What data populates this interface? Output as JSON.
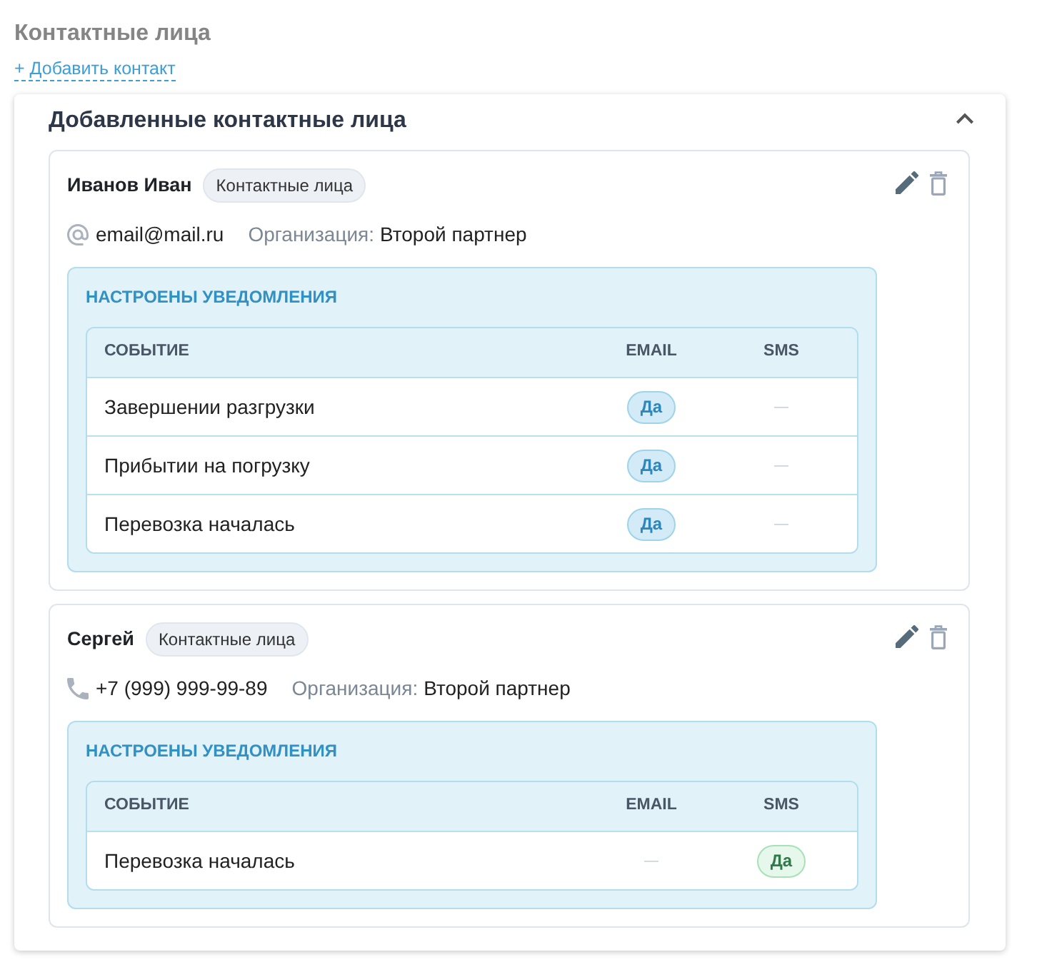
{
  "page": {
    "title": "Контактные лица",
    "add_link": "+ Добавить контакт"
  },
  "panel": {
    "title": "Добавленные контактные лица",
    "expanded": true
  },
  "contacts": [
    {
      "name": "Иванов Иван",
      "tag": "Контактные лица",
      "kind": "email",
      "contact": "email@mail.ru",
      "org_label": "Организация:",
      "org": "Второй партнер",
      "notifications": {
        "title": "НАСТРОЕНЫ УВЕДОМЛЕНИЯ",
        "columns": [
          {
            "label": "СОБЫТИЕ",
            "kind": "event"
          },
          {
            "label": "EMAIL",
            "kind": "email"
          },
          {
            "label": "SMS",
            "kind": "sms"
          }
        ],
        "rows": [
          {
            "cells": [
              {
                "text": "Завершении разгрузки"
              },
              {
                "on": true,
                "text": "Да"
              },
              {
                "on": false,
                "text": "—"
              }
            ]
          },
          {
            "cells": [
              {
                "text": "Прибытии на погрузку"
              },
              {
                "on": true,
                "text": "Да"
              },
              {
                "on": false,
                "text": "—"
              }
            ]
          },
          {
            "cells": [
              {
                "text": "Перевозка началась"
              },
              {
                "on": true,
                "text": "Да"
              },
              {
                "on": false,
                "text": "—"
              }
            ]
          }
        ]
      }
    },
    {
      "name": "Сергей",
      "tag": "Контактные лица",
      "kind": "phone",
      "contact": "+7 (999) 999-99-89",
      "org_label": "Организация:",
      "org": "Второй партнер",
      "notifications": {
        "title": "НАСТРОЕНЫ УВЕДОМЛЕНИЯ",
        "columns": [
          {
            "label": "СОБЫТИЕ",
            "kind": "event"
          },
          {
            "label": "EMAIL",
            "kind": "email"
          },
          {
            "label": "SMS",
            "kind": "sms"
          }
        ],
        "rows": [
          {
            "cells": [
              {
                "text": "Перевозка началась"
              },
              {
                "on": false,
                "text": "—"
              },
              {
                "on": true,
                "text": "Да"
              }
            ]
          }
        ]
      }
    }
  ]
}
